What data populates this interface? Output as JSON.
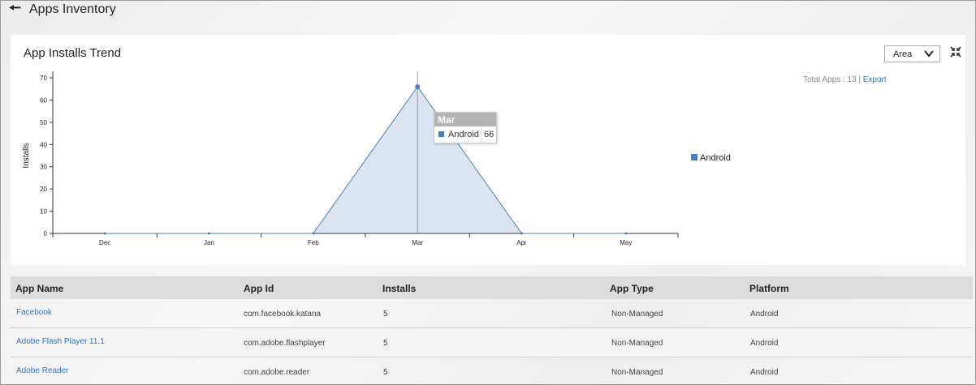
{
  "header": {
    "back_icon": "arrow-left-icon",
    "title": "Apps Inventory"
  },
  "chart_panel": {
    "title": "App Installs Trend",
    "chart_type_select": {
      "selected": "Area",
      "icon": "chevron-down-icon"
    },
    "collapse_icon": "collapse-arrows-icon",
    "total_apps_label": "Total Apps : 13 |",
    "export_label": "Export",
    "legend": [
      {
        "name": "Android",
        "color": "#4a7ebb"
      }
    ],
    "tooltip": {
      "title": "Mar",
      "series": "Android",
      "value": "66"
    }
  },
  "chart_data": {
    "type": "area",
    "categories": [
      "Dec",
      "Jan",
      "Feb",
      "Mar",
      "Apr",
      "May"
    ],
    "series": [
      {
        "name": "Android",
        "values": [
          0,
          0,
          0,
          66,
          0,
          0
        ],
        "color": "#4a7ebb"
      }
    ],
    "ylabel": "Installs",
    "xlabel": "",
    "ylim": [
      0,
      70
    ],
    "yticks": [
      0,
      10,
      20,
      30,
      40,
      50,
      60,
      70
    ],
    "highlight_category": "Mar",
    "legend_position": "right"
  },
  "table": {
    "columns": [
      "App Name",
      "App Id",
      "Installs",
      "App Type",
      "Platform"
    ],
    "rows": [
      [
        "Facebook",
        "com.facebook.katana",
        "5",
        "Non-Managed",
        "Android"
      ],
      [
        "Adobe Flash Player 11.1",
        "com.adobe.flashplayer",
        "5",
        "Non-Managed",
        "Android"
      ],
      [
        "Adobe Reader",
        "com.adobe.reader",
        "5",
        "Non-Managed",
        "Android"
      ]
    ]
  }
}
